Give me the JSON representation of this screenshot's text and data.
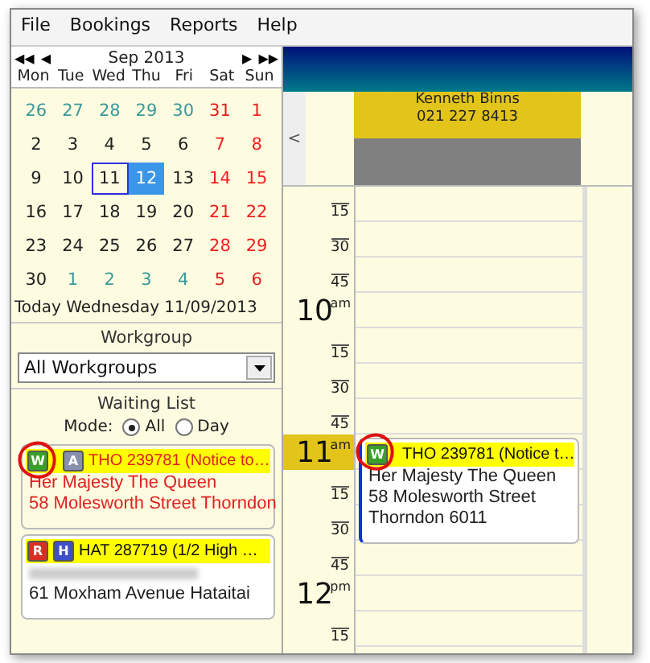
{
  "menu": [
    "File",
    "Bookings",
    "Reports",
    "Help"
  ],
  "calendar": {
    "month": "Sep 2013",
    "nav": {
      "first": "◀◀",
      "prev": "◀",
      "next": "▶",
      "last": "▶▶"
    },
    "weekdays": [
      "Mon",
      "Tue",
      "Wed",
      "Thu",
      "Fri",
      "Sat",
      "Sun"
    ],
    "weeks": [
      [
        {
          "d": "26",
          "other": true
        },
        {
          "d": "27",
          "other": true
        },
        {
          "d": "28",
          "other": true
        },
        {
          "d": "29",
          "other": true
        },
        {
          "d": "30",
          "other": true
        },
        {
          "d": "31",
          "other": true
        },
        {
          "d": "1",
          "other": false
        }
      ],
      [
        {
          "d": "2",
          "other": false
        },
        {
          "d": "3",
          "other": false
        },
        {
          "d": "4",
          "other": false
        },
        {
          "d": "5",
          "other": false
        },
        {
          "d": "6",
          "other": false
        },
        {
          "d": "7",
          "other": false
        },
        {
          "d": "8",
          "other": false
        }
      ],
      [
        {
          "d": "9",
          "other": false
        },
        {
          "d": "10",
          "other": false
        },
        {
          "d": "11",
          "other": false,
          "today": true
        },
        {
          "d": "12",
          "other": false,
          "selected": true
        },
        {
          "d": "13",
          "other": false
        },
        {
          "d": "14",
          "other": false
        },
        {
          "d": "15",
          "other": false
        }
      ],
      [
        {
          "d": "16",
          "other": false
        },
        {
          "d": "17",
          "other": false
        },
        {
          "d": "18",
          "other": false
        },
        {
          "d": "19",
          "other": false
        },
        {
          "d": "20",
          "other": false
        },
        {
          "d": "21",
          "other": false
        },
        {
          "d": "22",
          "other": false
        }
      ],
      [
        {
          "d": "23",
          "other": false
        },
        {
          "d": "24",
          "other": false
        },
        {
          "d": "25",
          "other": false
        },
        {
          "d": "26",
          "other": false
        },
        {
          "d": "27",
          "other": false
        },
        {
          "d": "28",
          "other": false
        },
        {
          "d": "29",
          "other": false
        }
      ],
      [
        {
          "d": "30",
          "other": false
        },
        {
          "d": "1",
          "other": true
        },
        {
          "d": "2",
          "other": true
        },
        {
          "d": "3",
          "other": true
        },
        {
          "d": "4",
          "other": true
        },
        {
          "d": "5",
          "other": true
        },
        {
          "d": "6",
          "other": true
        }
      ]
    ],
    "today_label": "Today Wednesday 11/09/2013"
  },
  "workgroup": {
    "label": "Workgroup",
    "value": "All Workgroups"
  },
  "waiting_list": {
    "title": "Waiting List",
    "mode_label": "Mode:",
    "modes": [
      {
        "label": "All",
        "selected": true
      },
      {
        "label": "Day",
        "selected": false
      }
    ],
    "items": [
      {
        "tags": [
          {
            "letter": "W",
            "color": "#3aa02a"
          },
          {
            "letter": "A",
            "color": "#8890b0"
          }
        ],
        "title": "THO 239781 (Notice to…",
        "lines": [
          {
            "kind": "text",
            "text": "Her Majesty The Queen"
          },
          {
            "kind": "text",
            "text": "58 Molesworth Street Thorndon"
          }
        ],
        "urgent": true,
        "annotated": true
      },
      {
        "tags": [
          {
            "letter": "R",
            "color": "#d83020"
          },
          {
            "letter": "H",
            "color": "#4050c8"
          }
        ],
        "title": "HAT 287719 (1/2 High …",
        "lines": [
          {
            "kind": "redacted"
          },
          {
            "kind": "text",
            "text": "61 Moxham Avenue Hataitai"
          }
        ],
        "urgent": false,
        "annotated": false
      }
    ]
  },
  "schedule": {
    "scroll_left": "<",
    "staff": {
      "name": "Kenneth Binns",
      "phone": "021 227 8413"
    },
    "slots": [
      {
        "kind": "minute",
        "label": "15"
      },
      {
        "kind": "minute",
        "label": "30"
      },
      {
        "kind": "minute",
        "label": "45"
      },
      {
        "kind": "hour",
        "label": "10",
        "suffix": "am",
        "current": false
      },
      {
        "kind": "minute",
        "label": "15"
      },
      {
        "kind": "minute",
        "label": "30"
      },
      {
        "kind": "minute",
        "label": "45"
      },
      {
        "kind": "hour",
        "label": "11",
        "suffix": "am",
        "current": true
      },
      {
        "kind": "minute",
        "label": "15"
      },
      {
        "kind": "minute",
        "label": "30"
      },
      {
        "kind": "minute",
        "label": "45"
      },
      {
        "kind": "hour",
        "label": "12",
        "suffix": "pm",
        "current": false
      },
      {
        "kind": "minute",
        "label": "15"
      }
    ],
    "appointment": {
      "tags": [
        {
          "letter": "W",
          "color": "#3aa02a"
        }
      ],
      "title": "THO 239781 (Notice t…",
      "lines": [
        "Her Majesty The Queen",
        "58 Molesworth Street",
        "Thorndon 6011"
      ],
      "annotated": true
    }
  }
}
